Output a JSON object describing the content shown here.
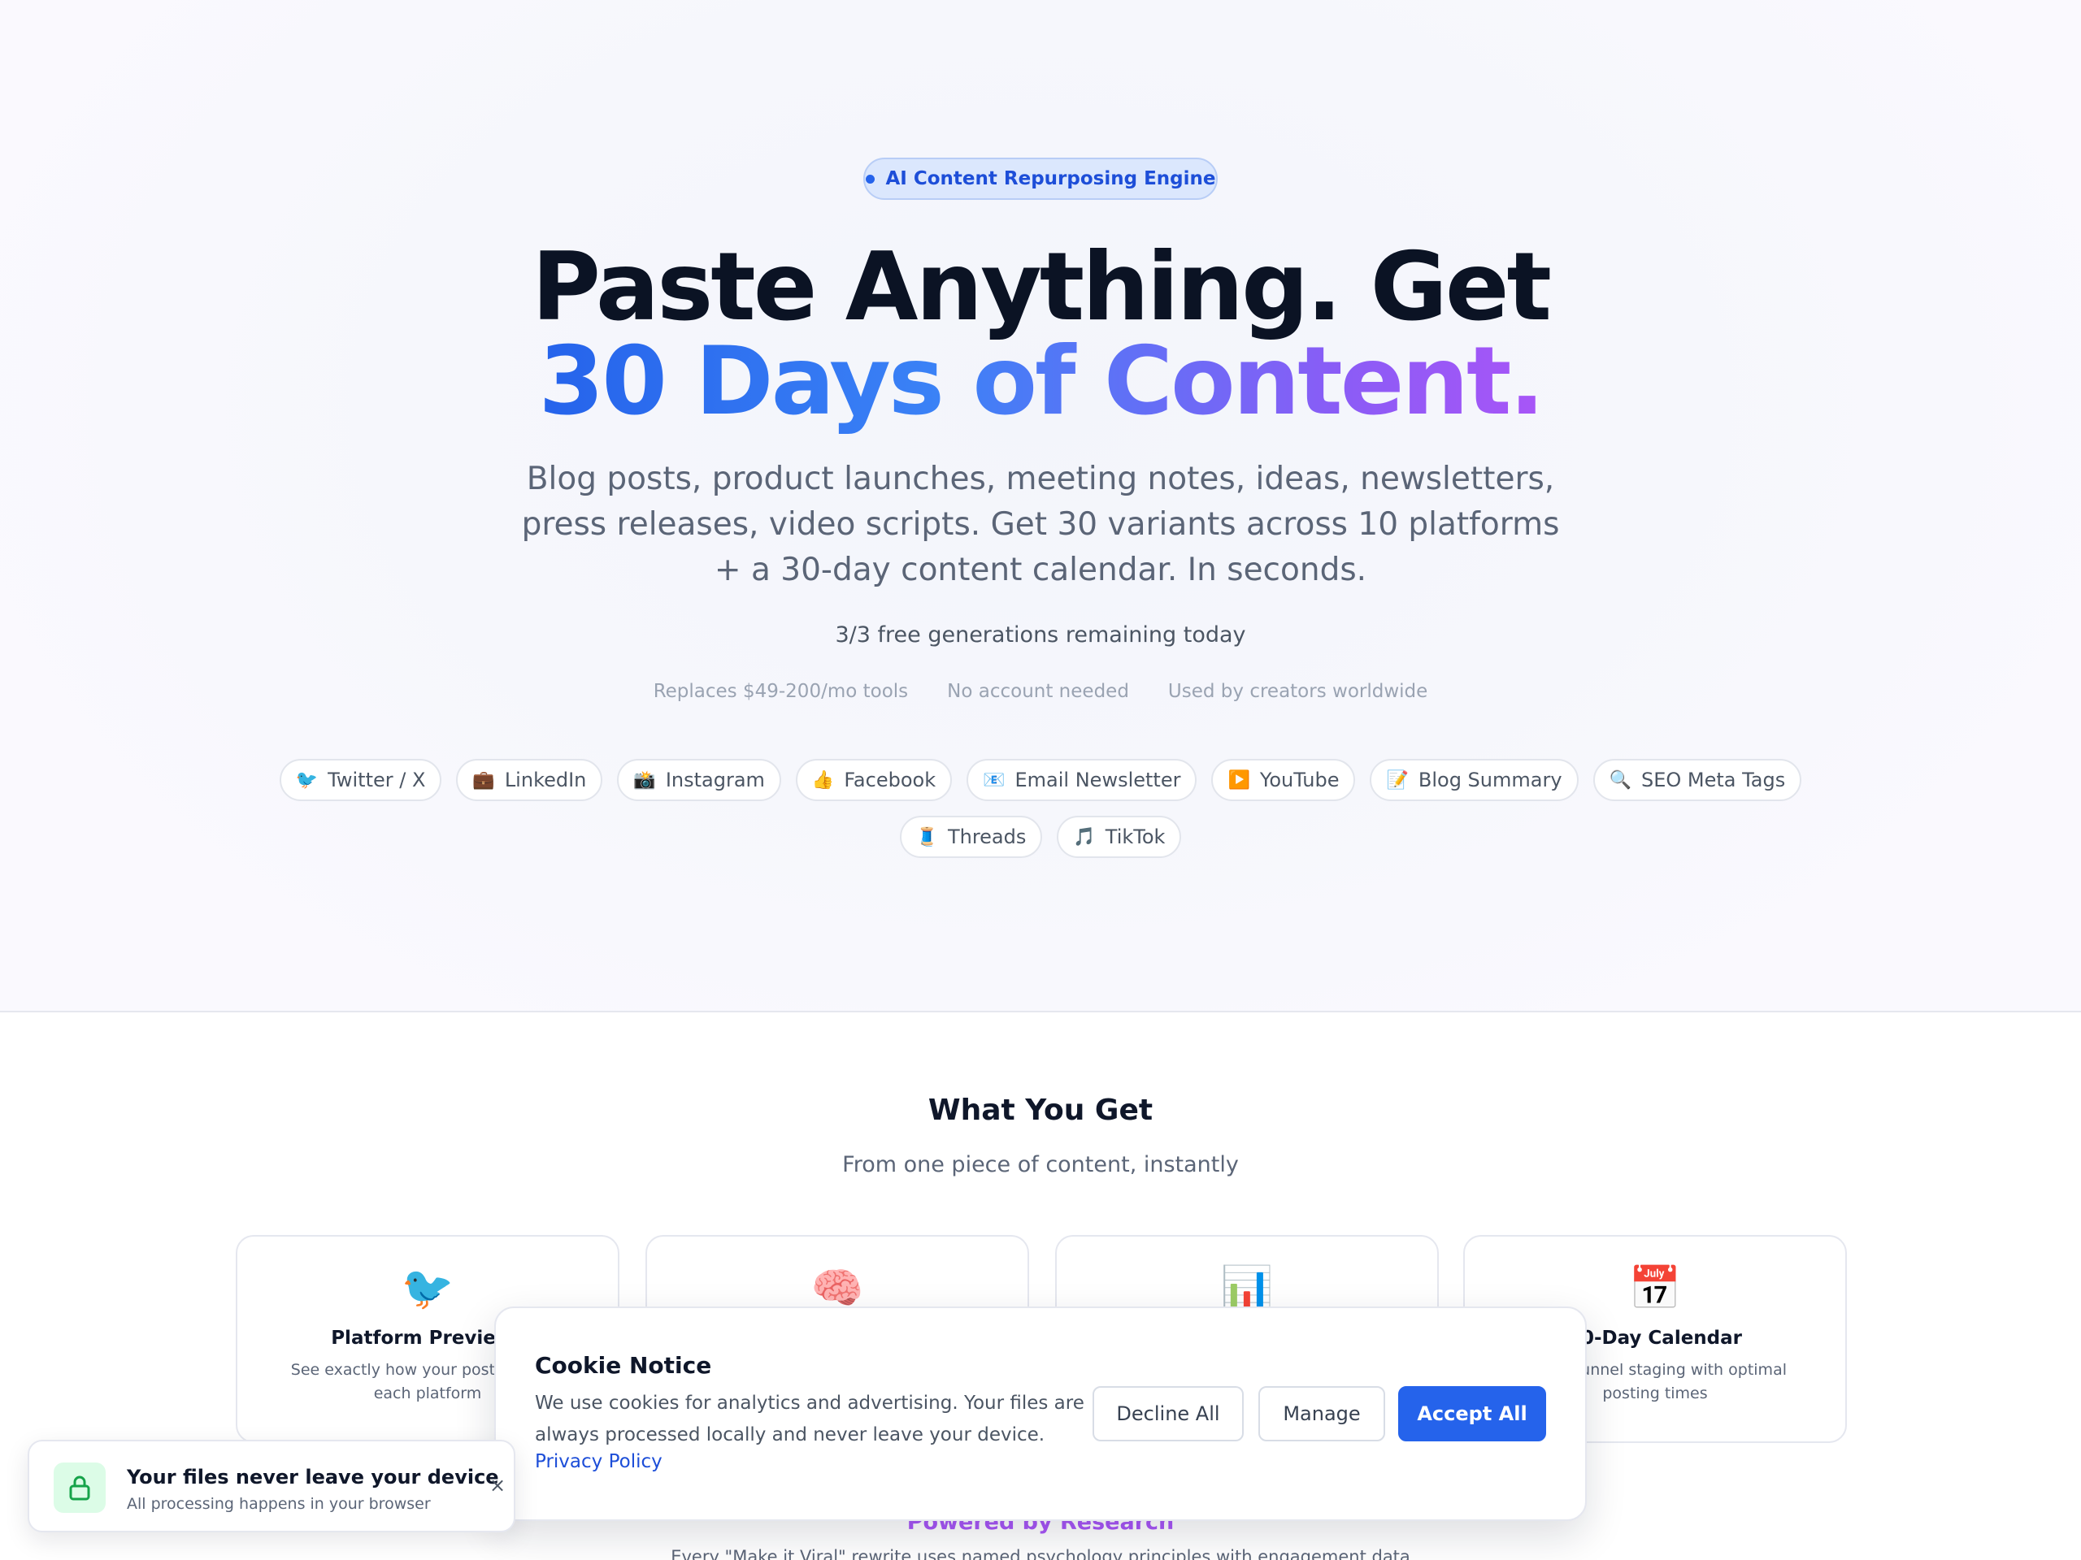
{
  "hero": {
    "badge": "AI Content Repurposing Engine",
    "headline_line1": "Paste Anything. Get",
    "headline_line2": "30 Days of Content.",
    "subtitle": "Blog posts, product launches, meeting notes, ideas, newsletters, press releases, video scripts. Get 30 variants across 10 platforms + a 30-day content calendar. In seconds.",
    "remaining": "3/3 free generations remaining today",
    "facts": [
      "Replaces $49-200/mo tools",
      "No account needed",
      "Used by creators worldwide"
    ],
    "platforms": [
      {
        "icon": "🐦",
        "label": "Twitter / X"
      },
      {
        "icon": "💼",
        "label": "LinkedIn"
      },
      {
        "icon": "📸",
        "label": "Instagram"
      },
      {
        "icon": "👍",
        "label": "Facebook"
      },
      {
        "icon": "📧",
        "label": "Email Newsletter"
      },
      {
        "icon": "▶️",
        "label": "YouTube"
      },
      {
        "icon": "📝",
        "label": "Blog Summary"
      },
      {
        "icon": "🔍",
        "label": "SEO Meta Tags"
      },
      {
        "icon": "🧵",
        "label": "Threads"
      },
      {
        "icon": "🎵",
        "label": "TikTok"
      }
    ]
  },
  "features": {
    "title": "What You Get",
    "subtitle": "From one piece of content, instantly",
    "cards": [
      {
        "icon": "🐦",
        "title": "Platform Previews",
        "desc": "See exactly how your post looks on each platform"
      },
      {
        "icon": "🧠",
        "title": "",
        "desc": ""
      },
      {
        "icon": "📊",
        "title": "",
        "desc": ""
      },
      {
        "icon": "📅",
        "title": "30-Day Calendar",
        "desc": "Smart funnel staging with optimal posting times"
      }
    ]
  },
  "research": {
    "title": "Powered by Research",
    "text": "Every \"Make it Viral\" rewrite uses named psychology principles with engagement data"
  },
  "cookie": {
    "title": "Cookie Notice",
    "body": "We use cookies for analytics and advertising. Your files are always processed locally and never leave your device.",
    "link": "Privacy Policy",
    "decline": "Decline All",
    "manage": "Manage",
    "accept": "Accept All"
  },
  "toast": {
    "title": "Your files never leave your device",
    "subtitle": "All processing happens in your browser",
    "close": "×"
  },
  "colors": {
    "accent": "#2563eb",
    "gradient_start": "#2563eb",
    "gradient_end": "#a855f7",
    "research_purple": "#a855f7",
    "toast_lock_bg": "#dcfce7"
  }
}
